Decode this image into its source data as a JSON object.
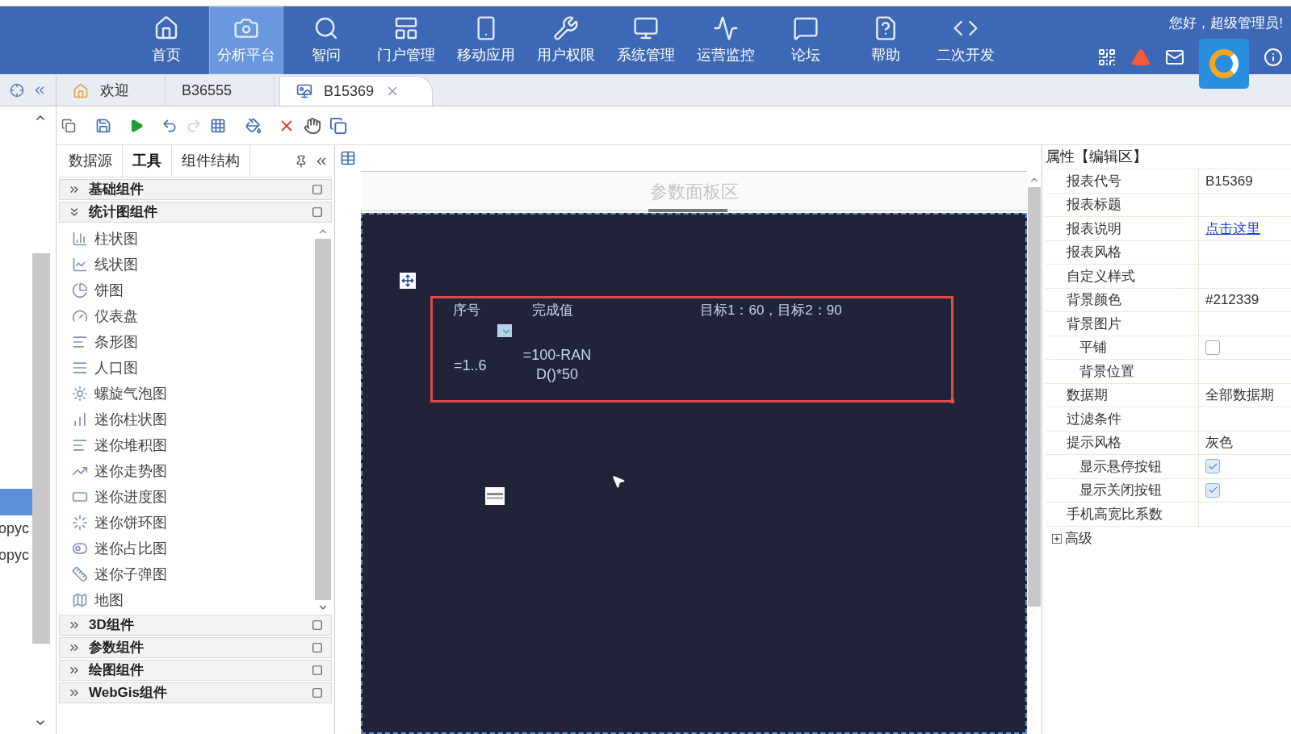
{
  "nav": {
    "items": [
      {
        "label": "首页",
        "selected": false
      },
      {
        "label": "分析平台",
        "selected": true
      },
      {
        "label": "智问",
        "selected": false
      },
      {
        "label": "门户管理",
        "selected": false
      },
      {
        "label": "移动应用",
        "selected": false
      },
      {
        "label": "用户权限",
        "selected": false
      },
      {
        "label": "系统管理",
        "selected": false
      },
      {
        "label": "运营监控",
        "selected": false
      },
      {
        "label": "论坛",
        "selected": false
      },
      {
        "label": "帮助",
        "selected": false
      },
      {
        "label": "二次开发",
        "selected": false
      }
    ],
    "greeting": "您好，超级管理员!"
  },
  "tabs": [
    {
      "label": "欢迎",
      "selected": false,
      "closable": false
    },
    {
      "label": "B36555",
      "selected": false,
      "closable": false
    },
    {
      "label": "B15369",
      "selected": true,
      "closable": true
    }
  ],
  "far_left": {
    "rows": [
      {
        "selected": true
      },
      {
        "label": "opyc",
        "selected": false
      },
      {
        "label": "opyc",
        "selected": false
      }
    ]
  },
  "left_panel": {
    "tabs": [
      {
        "label": "数据源",
        "selected": false
      },
      {
        "label": "工具",
        "selected": true
      },
      {
        "label": "组件结构",
        "selected": false
      }
    ],
    "sections": [
      {
        "title": "基础组件",
        "expanded": false
      },
      {
        "title": "统计图组件",
        "expanded": true,
        "items": [
          "柱状图",
          "线状图",
          "饼图",
          "仪表盘",
          "条形图",
          "人口图",
          "螺旋气泡图",
          "迷你柱状图",
          "迷你堆积图",
          "迷你走势图",
          "迷你进度图",
          "迷你饼环图",
          "迷你占比图",
          "迷你子弹图",
          "地图"
        ]
      },
      {
        "title": "3D组件",
        "expanded": false
      },
      {
        "title": "参数组件",
        "expanded": false
      },
      {
        "title": "绘图组件",
        "expanded": false
      },
      {
        "title": "WebGis组件",
        "expanded": false
      }
    ]
  },
  "canvas": {
    "param_panel_title": "参数面板区",
    "report": {
      "headers": [
        "序号",
        "完成值",
        "目标1：60，目标2：90"
      ],
      "cells": [
        "=1..6",
        "=100-RAND()*50"
      ]
    }
  },
  "properties": {
    "title": "属性【编辑区】",
    "rows": [
      {
        "label": "报表代号",
        "kind": "text",
        "value": "B15369"
      },
      {
        "label": "报表标题",
        "kind": "text"
      },
      {
        "label": "报表说明",
        "kind": "link",
        "value": "点击这里"
      },
      {
        "label": "报表风格",
        "kind": "text"
      },
      {
        "label": "自定义样式",
        "kind": "text"
      },
      {
        "label": "背景颜色",
        "kind": "text",
        "value": "#212339"
      },
      {
        "label": "背景图片",
        "kind": "text",
        "children": [
          {
            "label": "平铺",
            "kind": "checkbox",
            "checked": false
          },
          {
            "label": "背景位置",
            "kind": "text"
          }
        ]
      },
      {
        "label": "数据期",
        "kind": "text",
        "value": "全部数据期"
      },
      {
        "label": "过滤条件",
        "kind": "text"
      },
      {
        "label": "提示风格",
        "kind": "text",
        "value": "灰色",
        "children": [
          {
            "label": "显示悬停按钮",
            "kind": "checkbox",
            "checked": true
          },
          {
            "label": "显示关闭按钮",
            "kind": "checkbox",
            "checked": true
          }
        ]
      },
      {
        "label": "手机高宽比系数",
        "kind": "text"
      }
    ],
    "advanced": {
      "label": "高级",
      "expanded": false
    }
  }
}
